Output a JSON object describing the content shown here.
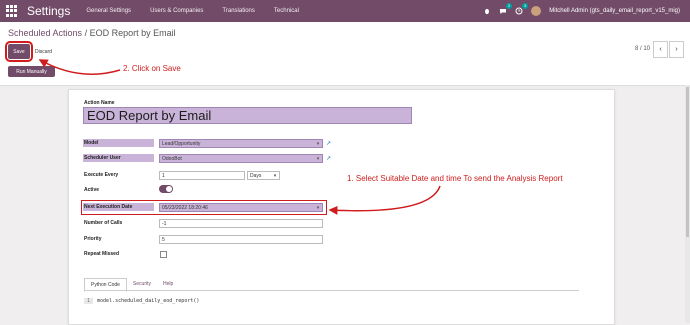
{
  "topbar": {
    "brand": "Settings",
    "menus": [
      "General Settings",
      "Users & Companies",
      "Translations",
      "Technical"
    ],
    "msg_count": "2",
    "activity_count": "3",
    "user": "Mitchell Admin (gts_daily_email_report_v15_mig)"
  },
  "breadcrumb": {
    "parent": "Scheduled Actions",
    "sep": " / ",
    "current": "EOD Report by Email"
  },
  "buttons": {
    "save": "Save",
    "discard": "Discard",
    "run": "Run Manually"
  },
  "pager": {
    "text": "8 / 10",
    "prev": "‹",
    "next": "›"
  },
  "form": {
    "name_label": "Action Name",
    "name_value": "EOD Report by Email",
    "model_label": "Model",
    "model_value": "Lead/Opportunity",
    "user_label": "Scheduler User",
    "user_value": "OdooBot",
    "every_label": "Execute Every",
    "every_value": "1",
    "every_unit": "Days",
    "active_label": "Active",
    "next_label": "Next Execution Date",
    "next_value": "05/23/2022 18:20:46",
    "calls_label": "Number of Calls",
    "calls_value": "-1",
    "priority_label": "Priority",
    "priority_value": "5",
    "repeat_label": "Repeat Missed"
  },
  "tabs": [
    "Python Code",
    "Security",
    "Help"
  ],
  "code": {
    "line": "1",
    "text": "model.scheduled_daily_eod_report()"
  },
  "annotations": {
    "step1": "1. Select Suitable Date and time To send the Analysis Report",
    "step2": "2. Click on Save"
  },
  "colors": {
    "brand": "#714b67",
    "annotation": "#d01c1c",
    "field_highlight": "#c9b3d8"
  }
}
